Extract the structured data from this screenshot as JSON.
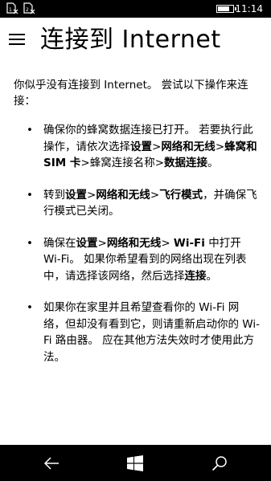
{
  "status_bar": {
    "sim1_icon": "sim-slot-1-icon",
    "sim2_icon": "sim-slot-2-icon",
    "battery_icon": "battery-icon",
    "battery_level": 0.8,
    "time": "11:14"
  },
  "header": {
    "menu_icon": "hamburger-menu-icon",
    "title": "连接到 Internet"
  },
  "content": {
    "intro": "你似乎没有连接到 Internet。 尝试以下操作来连接：",
    "bullet": "•",
    "tips": [
      {
        "parts": [
          {
            "t": "确保你的蜂窝数据连接已打开。 若要执行此操作，请依次选择"
          },
          {
            "t": "设置",
            "b": true
          },
          {
            "t": ">"
          },
          {
            "t": "网络和无线",
            "b": true
          },
          {
            "t": ">"
          },
          {
            "t": "蜂窝和 SIM 卡",
            "b": true
          },
          {
            "t": ">蜂窝连接名称>"
          },
          {
            "t": "数据连接",
            "b": true
          },
          {
            "t": "。"
          }
        ]
      },
      {
        "parts": [
          {
            "t": "转到"
          },
          {
            "t": "设置",
            "b": true
          },
          {
            "t": ">"
          },
          {
            "t": "网络和无线",
            "b": true
          },
          {
            "t": ">"
          },
          {
            "t": "飞行模式",
            "b": true
          },
          {
            "t": "，并确保飞行模式已关闭。"
          }
        ]
      },
      {
        "parts": [
          {
            "t": "确保在"
          },
          {
            "t": "设置",
            "b": true
          },
          {
            "t": ">"
          },
          {
            "t": "网络和无线",
            "b": true
          },
          {
            "t": "> "
          },
          {
            "t": "Wi-Fi",
            "b": true
          },
          {
            "t": " 中打开 Wi-Fi。 如果你希望看到的网络出现在列表中，请选择该网络，然后选择"
          },
          {
            "t": "连接",
            "b": true
          },
          {
            "t": "。"
          }
        ]
      },
      {
        "parts": [
          {
            "t": "如果你在家里并且希望查看你的 Wi-Fi 网络，但却没有看到它，则请重新启动你的 Wi-Fi 路由器。 应在其他方法失效时才使用此方法。"
          }
        ]
      }
    ]
  },
  "nav_bar": {
    "back_icon": "back-arrow-icon",
    "start_icon": "windows-start-icon",
    "search_icon": "search-icon"
  }
}
